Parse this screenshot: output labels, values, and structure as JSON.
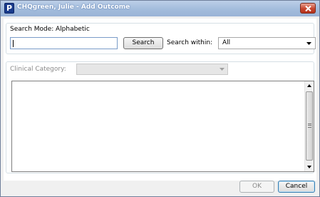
{
  "window": {
    "title": "CHQgreen, Julie - Add Outcome",
    "app_icon_letter": "P"
  },
  "search": {
    "mode_label": "Search Mode:",
    "mode_value": "Alphabetic",
    "input_value": "",
    "search_button": "Search",
    "within_label": "Search within:",
    "within_selected": "All"
  },
  "results": {
    "clinical_category_label": "Clinical Category:",
    "clinical_category_value": "",
    "items": []
  },
  "footer": {
    "ok_button": "OK",
    "cancel_button": "Cancel"
  }
}
